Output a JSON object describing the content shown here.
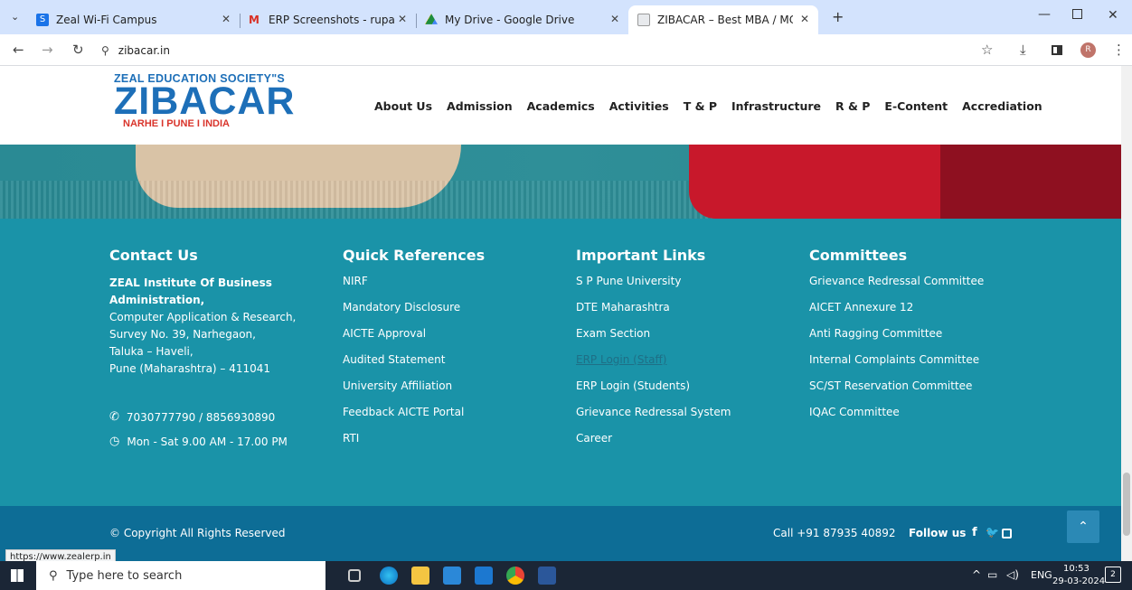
{
  "tabs": [
    {
      "title": "Zeal Wi-Fi Campus",
      "color": "#1a73e8"
    },
    {
      "title": "ERP Screenshots - rupali.pawar",
      "color": "#d93025"
    },
    {
      "title": "My Drive - Google Drive",
      "color": "#1e8e3e"
    },
    {
      "title": "ZIBACAR – Best MBA / MCA Co",
      "color": "#5f6368"
    }
  ],
  "address": "zibacar.in",
  "profile_initial": "R",
  "site": {
    "logo_top": "ZEAL EDUCATION SOCIETY\"S",
    "logo_main": "ZIBACAR",
    "logo_bottom": "NARHE I PUNE I INDIA",
    "nav": [
      "About Us",
      "Admission",
      "Academics",
      "Activities",
      "T & P",
      "Infrastructure",
      "R & P",
      "E-Content",
      "Accrediation"
    ]
  },
  "footer": {
    "contact": {
      "heading": "Contact Us",
      "name": "ZEAL Institute Of Business Administration,",
      "lines": [
        "Computer Application & Research,",
        "Survey No. 39, Narhegaon,",
        "Taluka – Haveli,",
        "Pune (Maharashtra) – 411041"
      ],
      "phone": "7030777790 / 8856930890",
      "hours": "Mon - Sat 9.00 AM - 17.00 PM"
    },
    "quick": {
      "heading": "Quick References",
      "items": [
        "NIRF",
        "Mandatory Disclosure",
        "AICTE Approval",
        "Audited Statement",
        "University Affiliation",
        "Feedback AICTE Portal",
        "RTI"
      ]
    },
    "links": {
      "heading": "Important Links",
      "items": [
        "S P Pune University",
        "DTE Maharashtra",
        "Exam Section",
        "ERP Login (Staff)",
        "ERP Login (Students)",
        "Grievance Redressal System",
        "Career"
      ]
    },
    "committees": {
      "heading": "Committees",
      "items": [
        "Grievance Redressal Committee",
        "AICET Annexure 12",
        "Anti Ragging Committee",
        "Internal Complaints Committee",
        "SC/ST Reservation Committee",
        "IQAC Committee"
      ]
    }
  },
  "bottom": {
    "copyright": "© Copyright All Rights Reserved",
    "call": "Call +91 87935 40892",
    "follow": "Follow us"
  },
  "status_url": "https://www.zealerp.in",
  "taskbar": {
    "search": "Type here to search",
    "lang": "ENG",
    "time": "10:53",
    "date": "29-03-2024",
    "notif": "2"
  }
}
